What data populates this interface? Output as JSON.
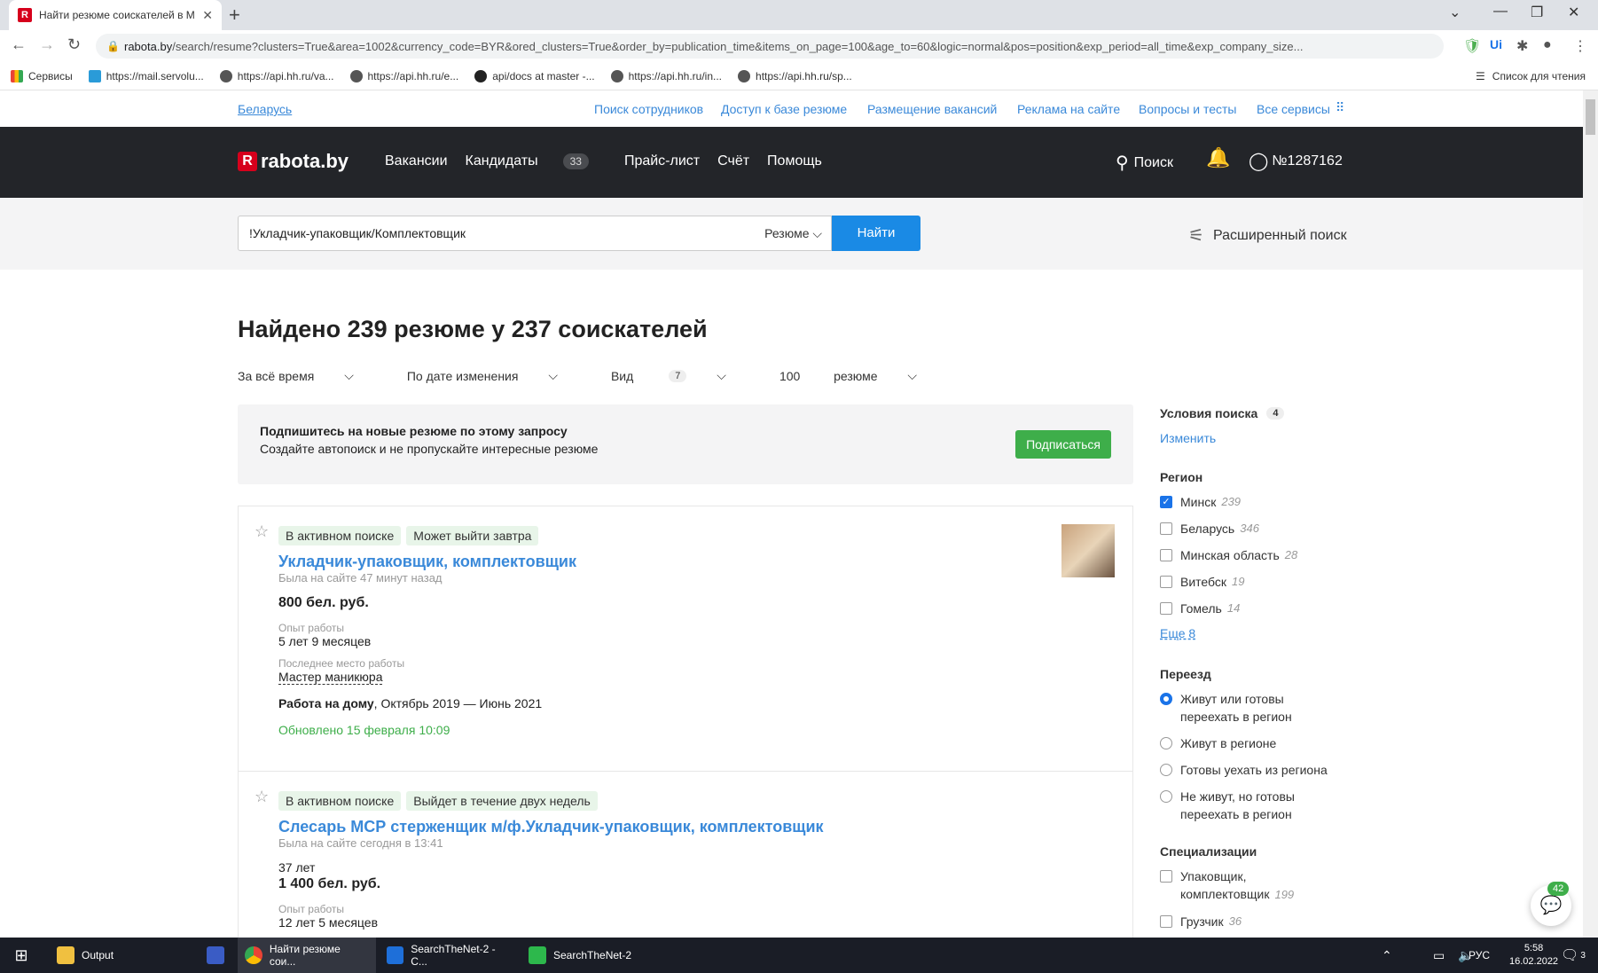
{
  "browser": {
    "tab_title": "Найти резюме соискателей в М",
    "url_host": "rabota.by",
    "url_path": "/search/resume?clusters=True&area=1002&currency_code=BYR&ored_clusters=True&order_by=publication_time&items_on_page=100&age_to=60&logic=normal&pos=position&exp_period=all_time&exp_company_size...",
    "bookmarks": [
      "Сервисы",
      "https://mail.servolu...",
      "https://api.hh.ru/va...",
      "https://api.hh.ru/e...",
      "api/docs at master -...",
      "https://api.hh.ru/in...",
      "https://api.hh.ru/sp..."
    ],
    "reading_list": "Список для чтения"
  },
  "topnav": {
    "region": "Беларусь",
    "links": [
      "Поиск сотрудников",
      "Доступ к базе резюме",
      "Размещение вакансий",
      "Реклама на сайте",
      "Вопросы и тесты",
      "Все сервисы"
    ]
  },
  "header": {
    "logo": "rabota.by",
    "nav": [
      "Вакансии",
      "Кандидаты",
      "Прайс-лист",
      "Счёт",
      "Помощь"
    ],
    "candidates_count": "33",
    "search": "Поиск",
    "account": "№1287162"
  },
  "search": {
    "query": "!Укладчик-упаковщик/Комплектовщик",
    "type": "Резюме",
    "button": "Найти",
    "advanced": "Расширенный поиск"
  },
  "results": {
    "title": "Найдено 239 резюме у 237 соискателей",
    "filters": {
      "period": "За всё время",
      "sort": "По дате изменения",
      "view": "Вид",
      "view_count": "7",
      "per_page": "100",
      "per_page_suffix": "резюме"
    }
  },
  "subscribe": {
    "title": "Подпишитесь на новые резюме по этому запросу",
    "text": "Создайте автопоиск и не пропускайте интересные резюме",
    "button": "Подписаться"
  },
  "cards": [
    {
      "tags": [
        "В активном поиске",
        "Может выйти завтра"
      ],
      "title": "Укладчик-упаковщик, комплектовщик",
      "seen": "Была на сайте 47 минут назад",
      "salary": "800 бел. руб.",
      "exp_label": "Опыт работы",
      "exp": "5 лет 9 месяцев",
      "last_label": "Последнее место работы",
      "last": "Мастер маникюра",
      "company": "Работа на дому",
      "period": ", Октябрь 2019 — Июнь 2021",
      "updated": "Обновлено 15 февраля 10:09"
    },
    {
      "tags": [
        "В активном поиске",
        "Выйдет в течение двух недель"
      ],
      "title": "Слесарь МСР стерженщик м/ф.Укладчик-упаковщик, комплектовщик",
      "seen": "Была на сайте сегодня в 13:41",
      "age": "37 лет",
      "salary": "1 400 бел. руб.",
      "exp_label": "Опыт работы",
      "exp": "12 лет 5 месяцев"
    }
  ],
  "sidebar": {
    "conditions": "Условия поиска",
    "conditions_count": "4",
    "change": "Изменить",
    "region_title": "Регион",
    "regions": [
      {
        "name": "Минск",
        "count": "239",
        "checked": true
      },
      {
        "name": "Беларусь",
        "count": "346"
      },
      {
        "name": "Минская область",
        "count": "28"
      },
      {
        "name": "Витебск",
        "count": "19"
      },
      {
        "name": "Гомель",
        "count": "14"
      }
    ],
    "more": "Еще 8",
    "relocation_title": "Переезд",
    "relocation": [
      "Живут или готовы переехать в регион",
      "Живут в регионе",
      "Готовы уехать из региона",
      "Не живут, но готовы переехать в регион"
    ],
    "spec_title": "Специализации",
    "specs": [
      {
        "name": "Упаковщик, комплектовщик",
        "count": "199"
      },
      {
        "name": "Грузчик",
        "count": "36"
      }
    ]
  },
  "chat_count": "42",
  "taskbar": {
    "items": [
      "Output",
      "Найти резюме сои...",
      "SearchTheNet-2 - C...",
      "SearchTheNet-2"
    ],
    "lang": "РУС",
    "time": "5:58",
    "date": "16.02.2022",
    "notif": "3"
  }
}
